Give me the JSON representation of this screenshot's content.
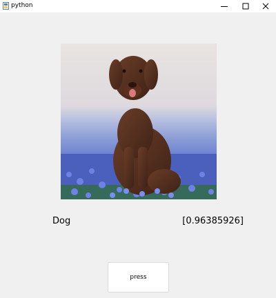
{
  "window": {
    "title": "python",
    "controls": [
      "minimize-icon",
      "maximize-icon",
      "close-icon"
    ]
  },
  "image": {
    "subject": "dog",
    "alt": "Chocolate labrador sitting in a field of blue flowers"
  },
  "prediction": {
    "label": "Dog",
    "score": "[0.96385926]"
  },
  "actions": {
    "press_label": "press"
  },
  "colors": {
    "background": "#f0f0f0",
    "titlebar": "#ffffff",
    "button_bg": "#ffffff",
    "button_border": "#dcdcdc"
  }
}
